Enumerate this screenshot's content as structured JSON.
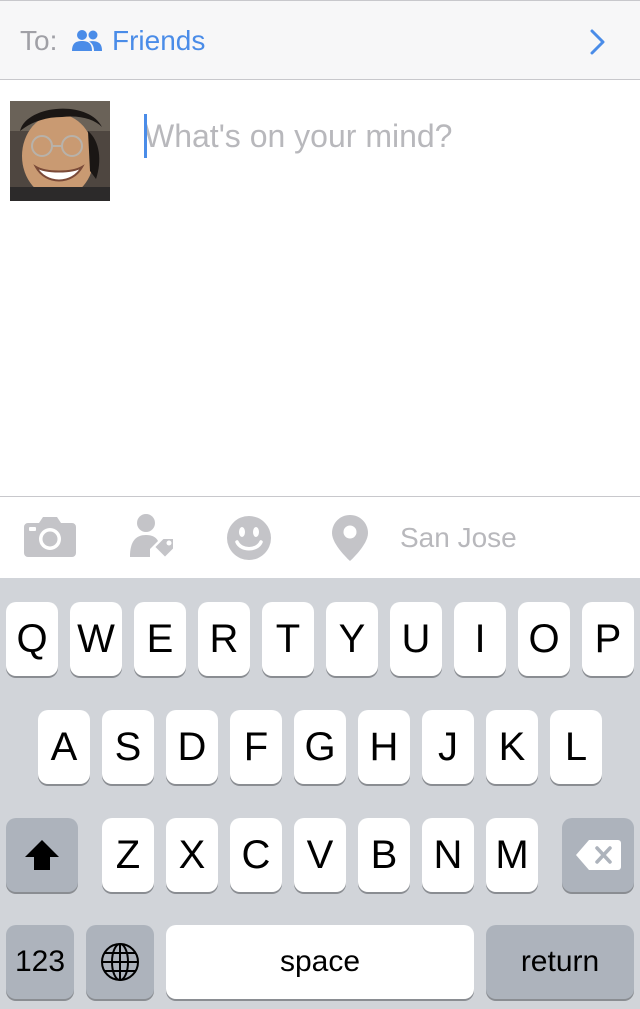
{
  "audience": {
    "to_label": "To:",
    "selected": "Friends",
    "icon": "friends-icon",
    "chevron_icon": "chevron-right-icon"
  },
  "composer": {
    "placeholder": "What's on your mind?",
    "value": "",
    "avatar": "user-avatar"
  },
  "attachments": {
    "icons": [
      "camera-icon",
      "tag-people-icon",
      "feeling-icon",
      "location-pin-icon"
    ],
    "location": "San Jose"
  },
  "keyboard": {
    "row1": [
      "Q",
      "W",
      "E",
      "R",
      "T",
      "Y",
      "U",
      "I",
      "O",
      "P"
    ],
    "row2": [
      "A",
      "S",
      "D",
      "F",
      "G",
      "H",
      "J",
      "K",
      "L"
    ],
    "row3": [
      "Z",
      "X",
      "C",
      "V",
      "B",
      "N",
      "M"
    ],
    "numbers_label": "123",
    "space_label": "space",
    "return_label": "return"
  },
  "colors": {
    "accent": "#4a8ce8",
    "placeholder": "#b8b8bc",
    "keyboard_bg": "#d1d4d9",
    "dark_key": "#adb3bc"
  }
}
